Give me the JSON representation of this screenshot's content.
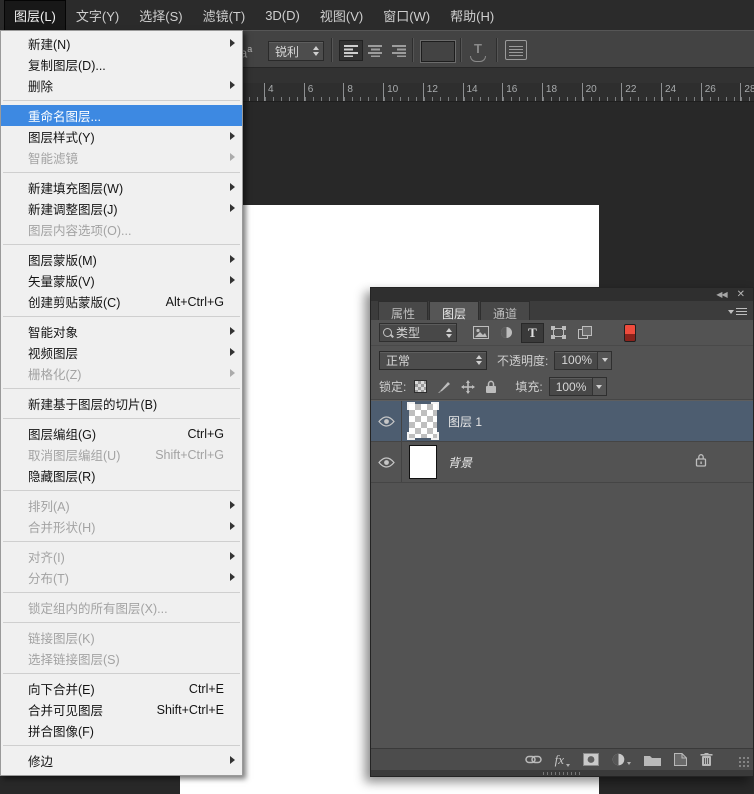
{
  "menu_bar": {
    "items": [
      {
        "label": "图层(L)",
        "active": true
      },
      {
        "label": "文字(Y)"
      },
      {
        "label": "选择(S)"
      },
      {
        "label": "滤镜(T)"
      },
      {
        "label": "3D(D)"
      },
      {
        "label": "视图(V)"
      },
      {
        "label": "窗口(W)"
      },
      {
        "label": "帮助(H)"
      }
    ]
  },
  "options_bar": {
    "anti_alias_icon": "aa",
    "anti_alias_value": "锐利",
    "alignment_icons": [
      "align-left",
      "align-center",
      "align-right"
    ],
    "alignment_selected": "align-left",
    "text_color_swatch": "#ffffff",
    "warp_text_icon": "warp-text-icon",
    "toggle_panels_icon": "character-panel-icon"
  },
  "ruler": {
    "numbers": [
      "4",
      "6",
      "8",
      "10",
      "12",
      "14",
      "16",
      "18",
      "20",
      "22",
      "24",
      "26",
      "28"
    ]
  },
  "layer_menu": {
    "items": [
      {
        "label": "新建(N)",
        "submenu": true
      },
      {
        "label": "复制图层(D)..."
      },
      {
        "label": "删除",
        "submenu": true
      },
      {
        "type": "separator"
      },
      {
        "label": "重命名图层...",
        "highlighted": true
      },
      {
        "label": "图层样式(Y)",
        "submenu": true
      },
      {
        "label": "智能滤镜",
        "submenu": true,
        "disabled": true
      },
      {
        "type": "separator"
      },
      {
        "label": "新建填充图层(W)",
        "submenu": true
      },
      {
        "label": "新建调整图层(J)",
        "submenu": true
      },
      {
        "label": "图层内容选项(O)...",
        "disabled": true
      },
      {
        "type": "separator"
      },
      {
        "label": "图层蒙版(M)",
        "submenu": true
      },
      {
        "label": "矢量蒙版(V)",
        "submenu": true
      },
      {
        "label": "创建剪贴蒙版(C)",
        "shortcut": "Alt+Ctrl+G"
      },
      {
        "type": "separator"
      },
      {
        "label": "智能对象",
        "submenu": true
      },
      {
        "label": "视频图层",
        "submenu": true
      },
      {
        "label": "栅格化(Z)",
        "submenu": true,
        "disabled": true
      },
      {
        "type": "separator"
      },
      {
        "label": "新建基于图层的切片(B)"
      },
      {
        "type": "separator"
      },
      {
        "label": "图层编组(G)",
        "shortcut": "Ctrl+G"
      },
      {
        "label": "取消图层编组(U)",
        "shortcut": "Shift+Ctrl+G",
        "disabled": true
      },
      {
        "label": "隐藏图层(R)"
      },
      {
        "type": "separator"
      },
      {
        "label": "排列(A)",
        "submenu": true,
        "disabled": true,
        "dark_arrow": true
      },
      {
        "label": "合并形状(H)",
        "submenu": true,
        "disabled": true,
        "dark_arrow": true
      },
      {
        "type": "separator"
      },
      {
        "label": "对齐(I)",
        "submenu": true,
        "disabled": true,
        "dark_arrow": true
      },
      {
        "label": "分布(T)",
        "submenu": true,
        "disabled": true,
        "dark_arrow": true
      },
      {
        "type": "separator"
      },
      {
        "label": "锁定组内的所有图层(X)...",
        "disabled": true
      },
      {
        "type": "separator"
      },
      {
        "label": "链接图层(K)",
        "disabled": true
      },
      {
        "label": "选择链接图层(S)",
        "disabled": true
      },
      {
        "type": "separator"
      },
      {
        "label": "向下合并(E)",
        "shortcut": "Ctrl+E"
      },
      {
        "label": "合并可见图层",
        "shortcut": "Shift+Ctrl+E"
      },
      {
        "label": "拼合图像(F)"
      },
      {
        "type": "separator"
      },
      {
        "label": "修边",
        "submenu": true
      }
    ]
  },
  "layers_panel": {
    "window_icons": [
      "collapse-to-icons-icon",
      "close-icon"
    ],
    "tabs": [
      {
        "label": "属性"
      },
      {
        "label": "图层",
        "active": true
      },
      {
        "label": "通道"
      }
    ],
    "panel_menu_icon": "panel-menu-icon",
    "filter": {
      "search_icon": "search-icon",
      "type_value": "类型",
      "filter_icons": [
        "pixel-layer-filter-icon",
        "adjustment-layer-filter-icon",
        "type-layer-filter-icon",
        "shape-layer-filter-icon",
        "smart-object-filter-icon"
      ],
      "filter_selected": "type-layer-filter-icon",
      "filter_switch_color": "#ee4b3c"
    },
    "blend_mode": "正常",
    "opacity_label": "不透明度:",
    "opacity_value": "100%",
    "lock_label": "锁定:",
    "lock_icons": [
      "lock-transparency-icon",
      "lock-paint-icon",
      "lock-position-icon",
      "lock-all-icon"
    ],
    "fill_label": "填充:",
    "fill_value": "100%",
    "layers": [
      {
        "name": "图层 1",
        "selected": true,
        "thumb": "checker",
        "visible": true
      },
      {
        "name": "背景",
        "italic": true,
        "locked": true,
        "thumb": "white",
        "visible": true
      }
    ],
    "bottom_icons": [
      "link-layers-icon",
      "layer-style-icon",
      "add-mask-icon",
      "new-adjustment-layer-icon",
      "new-group-icon",
      "new-layer-icon",
      "delete-layer-icon"
    ],
    "fx_label": "fx"
  }
}
